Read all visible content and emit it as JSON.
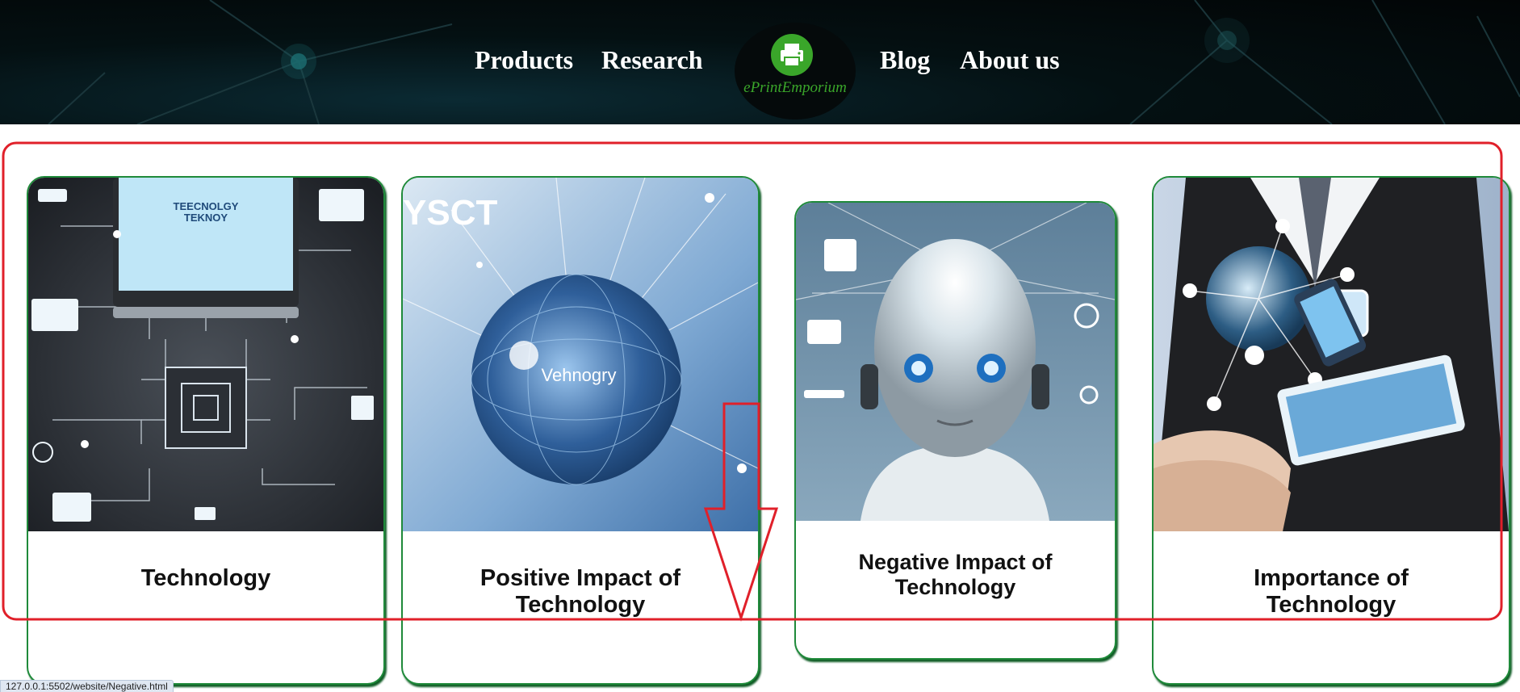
{
  "nav": {
    "products": "Products",
    "research": "Research",
    "blog": "Blog",
    "about": "About us"
  },
  "logo": {
    "text": "ePrintEmporium",
    "icon": "printer-icon",
    "color": "#3aa62a"
  },
  "cards": [
    {
      "title_line1": "Technology",
      "title_line2": "",
      "image_text": "TEECNOLGY TEKNOY",
      "image": "circuit-board-image"
    },
    {
      "title_line1": "Positive Impact of",
      "title_line2": "Technology",
      "image_text": "Vehnogry",
      "image_text_corner": "YSCT",
      "image": "digital-globe-image"
    },
    {
      "title_line1": "Negative Impact of",
      "title_line2": "Technology",
      "image": "robot-head-image"
    },
    {
      "title_line1": "Importance of",
      "title_line2": "Technology",
      "image": "businessman-globe-image"
    }
  ],
  "status_url": "127.0.0.1:5502/website/Negative.html",
  "colors": {
    "card_border": "#1f8a3a",
    "annotation": "#e0202a",
    "header_bg": "#020506"
  }
}
